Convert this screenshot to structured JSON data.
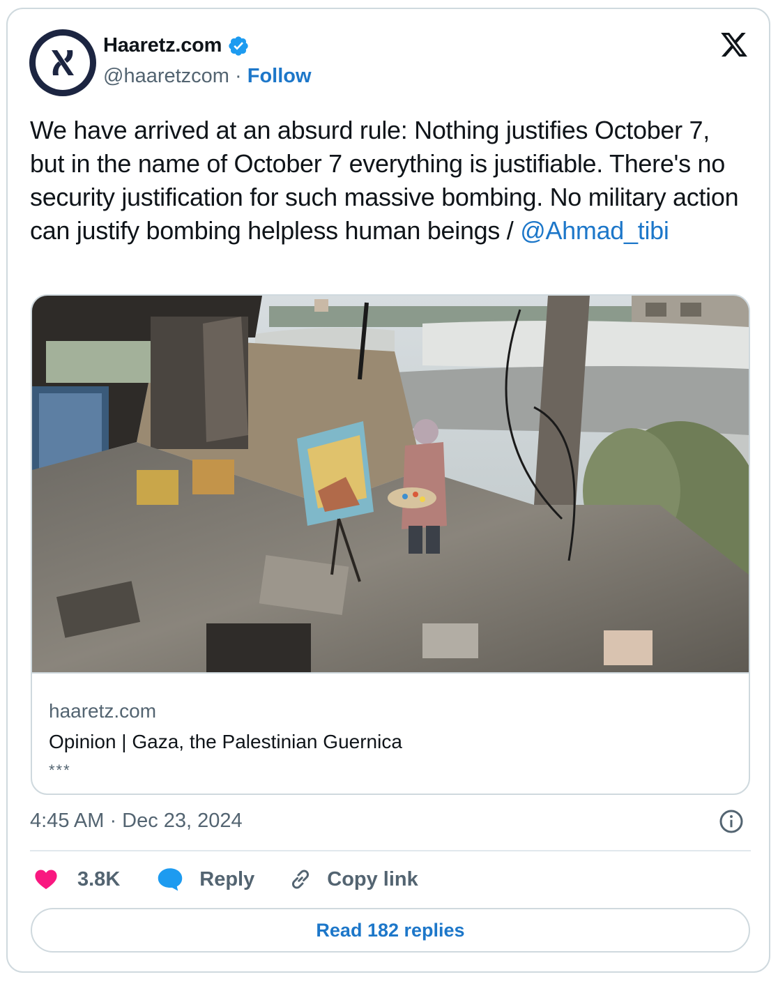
{
  "account": {
    "name": "Haaretz.com",
    "handle": "@haaretzcom",
    "separator": "·",
    "follow_label": "Follow",
    "logo_letter": "א"
  },
  "tweet": {
    "text": "We have arrived at an absurd rule: Nothing justifies October 7, but in the name of October 7 everything is justifiable. There's no security justification for such massive bombing. No military action can justify bombing helpless human beings / ",
    "mention": "@Ahmad_tibi"
  },
  "link_card": {
    "image_icon": "photo-of-painter-in-bombed-building",
    "domain": "haaretz.com",
    "title": "Opinion | Gaza, the Palestinian Guernica",
    "description": "***"
  },
  "timestamp": "4:45 AM · Dec 23, 2024",
  "actions": {
    "like_count": "3.8K",
    "reply_label": "Reply",
    "copy_label": "Copy link"
  },
  "read_replies_label": "Read 182 replies",
  "colors": {
    "accent": "#1d77c9",
    "like": "#f91880",
    "reply_bubble": "#1d9bf0",
    "text": "#0f1419",
    "secondary": "#536471",
    "border": "#cfd9de"
  }
}
